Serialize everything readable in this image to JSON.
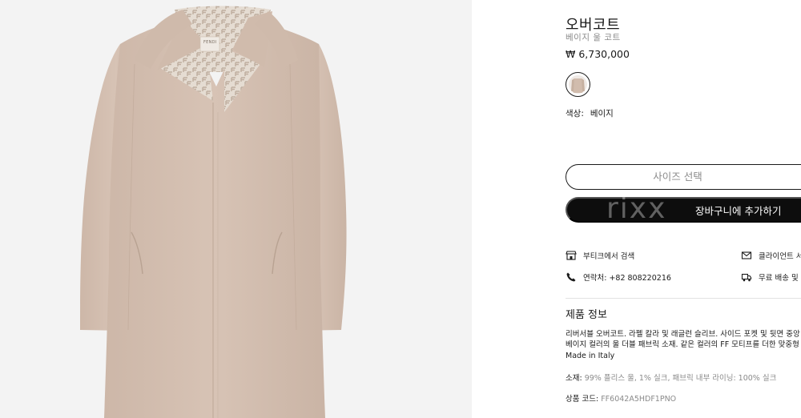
{
  "product": {
    "title": "오버코트",
    "subtitle": "베이지 울 코트",
    "price": "₩ 6,730,000",
    "color_label": "색상:",
    "color_value": "베이지",
    "label_text": "FENDI"
  },
  "actions": {
    "size_select_label": "사이즈 선택",
    "add_to_cart_label": "장바구니에 추가하기",
    "watermark": "rixx"
  },
  "services": {
    "boutique": "부티크에서 검색",
    "contact": "연락처: +82 808220216",
    "client": "클라이언트 서",
    "shipping": "무료 배송 및"
  },
  "info": {
    "title": "제품 정보",
    "desc_line1": "리버서블 오버코트. 라펠 칼라 및 래글런 슬리브. 사이드 포켓 및 뒷면 중앙",
    "desc_line2": "베이지 컬러의 울 더블 패브릭 소재. 같은 컬러의 FF 모티프를 더한 맞중형",
    "made_in": "Made in Italy",
    "material_label": "소재:",
    "material_value": "99% 플리스 울, 1% 실크, 패브릭 내부 라이닝: 100% 실크",
    "code_label": "상품 코드:",
    "code_value": "FF6042A5HDF1PNO"
  },
  "colors": {
    "coat": "#d5c0b1",
    "coat_shadow": "#c7b0a1",
    "lining_dark": "#bfae9f",
    "lining_light": "#e5dcd2",
    "panel_bg": "#f3f3f3",
    "button_dark": "#0d0d0d"
  },
  "icons": {
    "store": "store-icon",
    "phone": "phone-icon",
    "mail": "mail-icon",
    "truck": "truck-icon"
  }
}
